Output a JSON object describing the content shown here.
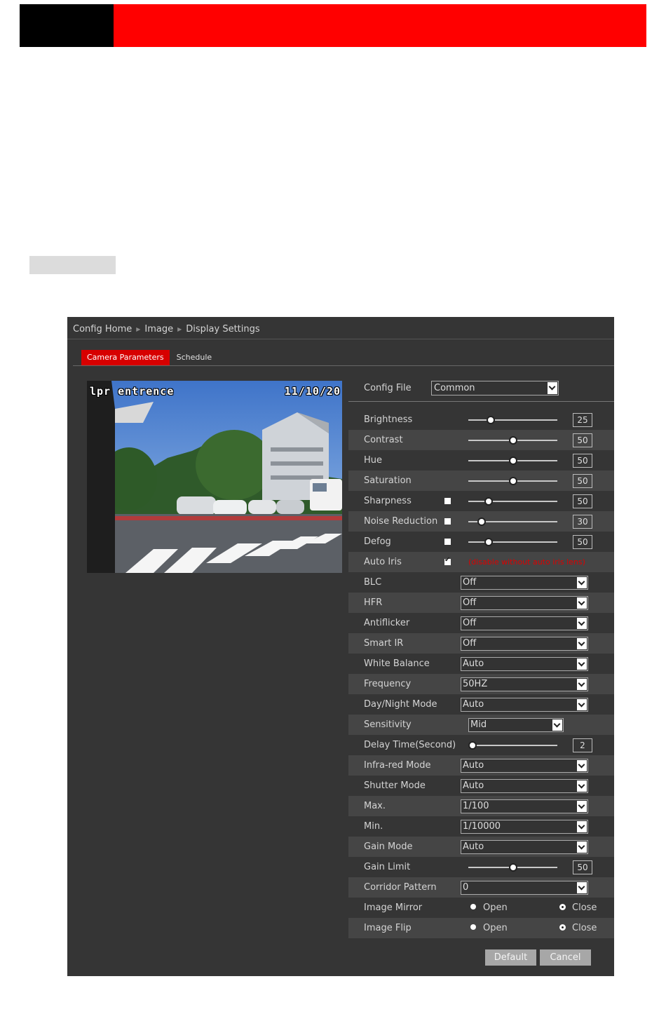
{
  "breadcrumb": [
    "Config Home",
    "Image",
    "Display Settings"
  ],
  "tabs": [
    {
      "label": "Camera Parameters",
      "active": true
    },
    {
      "label": "Schedule",
      "active": false
    }
  ],
  "camera": {
    "osd_name": "lpr entrence",
    "osd_date": "11/10/20"
  },
  "config_file": {
    "label": "Config File",
    "value": "Common"
  },
  "params": [
    {
      "type": "slider",
      "label": "Brightness",
      "value": "25",
      "level": 25
    },
    {
      "type": "slider",
      "label": "Contrast",
      "value": "50",
      "level": 50
    },
    {
      "type": "slider",
      "label": "Hue",
      "value": "50",
      "level": 50
    },
    {
      "type": "slider",
      "label": "Saturation",
      "value": "50",
      "level": 50
    },
    {
      "type": "slider",
      "label": "Sharpness",
      "value": "50",
      "level": 23,
      "checkbox": false
    },
    {
      "type": "slider",
      "label": "Noise Reduction",
      "value": "30",
      "level": 15,
      "checkbox": false
    },
    {
      "type": "slider",
      "label": "Defog",
      "value": "50",
      "level": 23,
      "checkbox": false
    },
    {
      "type": "note",
      "label": "Auto Iris",
      "checkbox": true,
      "note": "(disable without auto iris lens)"
    },
    {
      "type": "select",
      "label": "BLC",
      "value": "Off"
    },
    {
      "type": "select",
      "label": "HFR",
      "value": "Off"
    },
    {
      "type": "select",
      "label": "Antiflicker",
      "value": "Off"
    },
    {
      "type": "select",
      "label": "Smart IR",
      "value": "Off"
    },
    {
      "type": "select",
      "label": "White Balance",
      "value": "Auto"
    },
    {
      "type": "select",
      "label": "Frequency",
      "value": "50HZ"
    },
    {
      "type": "select",
      "label": "Day/Night Mode",
      "value": "Auto"
    },
    {
      "type": "select-small",
      "label": "Sensitivity",
      "value": "Mid"
    },
    {
      "type": "slider",
      "label": "Delay Time(Second)",
      "value": "2",
      "level": 5
    },
    {
      "type": "select",
      "label": "Infra-red Mode",
      "value": "Auto"
    },
    {
      "type": "select",
      "label": "Shutter Mode",
      "value": "Auto"
    },
    {
      "type": "select",
      "label": "Max.",
      "value": "1/100"
    },
    {
      "type": "select",
      "label": "Min.",
      "value": "1/10000"
    },
    {
      "type": "select",
      "label": "Gain Mode",
      "value": "Auto"
    },
    {
      "type": "slider",
      "label": "Gain Limit",
      "value": "50",
      "level": 50
    },
    {
      "type": "select",
      "label": "Corridor Pattern",
      "value": "0"
    },
    {
      "type": "radio",
      "label": "Image Mirror",
      "options": [
        "Open",
        "Close"
      ],
      "selected": 1
    },
    {
      "type": "radio",
      "label": "Image Flip",
      "options": [
        "Open",
        "Close"
      ],
      "selected": 1
    }
  ],
  "buttons": {
    "default": "Default",
    "cancel": "Cancel"
  }
}
